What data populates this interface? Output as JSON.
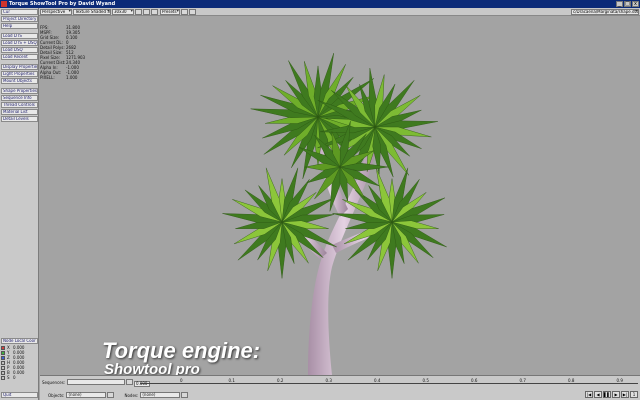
{
  "window": {
    "title": "Torque ShowTool Pro by David Wyand",
    "controls": [
      "_",
      "□",
      "x"
    ]
  },
  "toolbar": {
    "top_left_select": "Cur",
    "render_mode": "Perspective",
    "shading": "Texture Shaded Solid",
    "grid": "30x30",
    "presets": "Presets",
    "file_path": "c/Dracaena/Marginata/shape.dts"
  },
  "leftpanel": {
    "buttons": [
      "Project Directory",
      "Help",
      "Load DTS",
      "Load DTS + DSQ",
      "Load DSQ",
      "Load Recent",
      "Display Properties",
      "Light Properties",
      "Mount Objects",
      "Shape Properties",
      "Sequence Info",
      "Thread Controls",
      "Material List",
      "Detail Levels"
    ],
    "node_local_coords": "Node Local Coor",
    "coords": [
      {
        "label": "X",
        "value": "0.000",
        "color": "#d04040"
      },
      {
        "label": "Y",
        "value": "0.000",
        "color": "#40b040"
      },
      {
        "label": "Z",
        "value": "0.000",
        "color": "#4060d0"
      },
      {
        "label": "H",
        "value": "0.000",
        "color": "#c0c0c0"
      },
      {
        "label": "P",
        "value": "0.000",
        "color": "#c0c0c0"
      },
      {
        "label": "B",
        "value": "0.000",
        "color": "#c0c0c0"
      },
      {
        "label": "S",
        "value": "0",
        "color": "#c0c0c0"
      }
    ],
    "quit_label": "Quit"
  },
  "stats": [
    {
      "k": "FPS:",
      "v": "31.800"
    },
    {
      "k": "MSPF:",
      "v": "19.305"
    },
    {
      "k": "Grid Size:",
      "v": "0.100"
    },
    {
      "k": "Current DL:",
      "v": "0"
    },
    {
      "k": "Detail Polys:",
      "v": "2682"
    },
    {
      "k": "Detail Size:",
      "v": "512"
    },
    {
      "k": "Pixel Size:",
      "v": "1271.903"
    },
    {
      "k": "Current Dist:",
      "v": "24.340"
    },
    {
      "k": "Alpha In:",
      "v": "-1.000"
    },
    {
      "k": "Alpha Out:",
      "v": "-1.000"
    },
    {
      "k": "PIXELL:",
      "v": "1.000"
    }
  ],
  "overlay": {
    "line1": "Torque engine:",
    "line2": "Showtool pro"
  },
  "bottom": {
    "sequences_label": "Sequences:",
    "objects_label": "Objects:",
    "objects_value": "(none)",
    "nodes_label": "Nodes:",
    "nodes_value": "(none)",
    "time_value": "0.000",
    "ticks": [
      "0",
      "0.1",
      "0.2",
      "0.3",
      "0.4",
      "0.5",
      "0.6",
      "0.7",
      "0.8",
      "0.9",
      "1.0"
    ],
    "transport": [
      "|◀",
      "◀",
      "▌▌",
      "▶",
      "▶|",
      "1"
    ]
  },
  "colors": {
    "titlebar": "#0b2a78",
    "panel": "#c9c9c9",
    "viewport": "#a3a3a3",
    "leaf": "#3f7a1f",
    "trunk": "#c9b0c6"
  }
}
